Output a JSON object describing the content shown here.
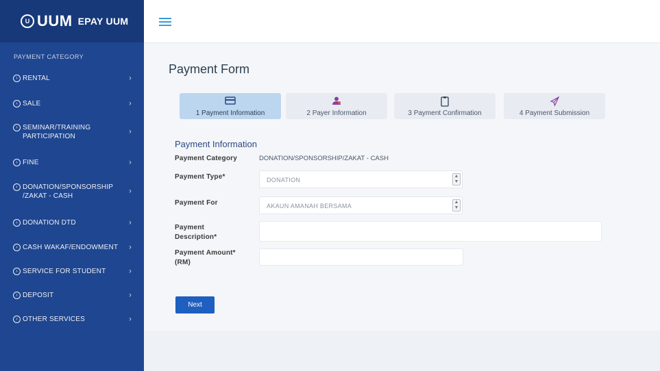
{
  "brand": {
    "logo_text": "UUM",
    "title": "EPAY UUM"
  },
  "sidebar": {
    "category_title": "PAYMENT CATEGORY",
    "items": [
      {
        "label": "RENTAL"
      },
      {
        "label": "SALE"
      },
      {
        "label": "SEMINAR/TRAINING PARTICIPATION"
      },
      {
        "label": "FINE"
      },
      {
        "label": "DONATION/SPONSORSHIP /ZAKAT - CASH"
      },
      {
        "label": "DONATION DTD"
      },
      {
        "label": "CASH WAKAF/ENDOWMENT"
      },
      {
        "label": "SERVICE FOR STUDENT"
      },
      {
        "label": "DEPOSIT"
      },
      {
        "label": "OTHER SERVICES"
      }
    ]
  },
  "page": {
    "title": "Payment Form"
  },
  "steps": [
    {
      "label": "1 Payment Information",
      "icon": "credit-card-icon"
    },
    {
      "label": "2 Payer Information",
      "icon": "user-icon"
    },
    {
      "label": "3 Payment Confirmation",
      "icon": "clipboard-icon"
    },
    {
      "label": "4 Payment Submission",
      "icon": "send-icon"
    }
  ],
  "form": {
    "section_title": "Payment Information",
    "category_label": "Payment Category",
    "category_value": "DONATION/SPONSORSHIP/ZAKAT - CASH",
    "type_label": "Payment Type*",
    "type_value": "DONATION",
    "for_label": "Payment For",
    "for_value": "AKAUN AMANAH BERSAMA",
    "desc_label_1": "Payment",
    "desc_label_2": "Description*",
    "desc_value": "",
    "amount_label_1": "Payment Amount*",
    "amount_label_2": "(RM)",
    "amount_value": "",
    "next_label": "Next"
  },
  "colors": {
    "sidebar": "#1f4690",
    "accent": "#1e5fbf",
    "active_step": "#bcd6ef"
  }
}
